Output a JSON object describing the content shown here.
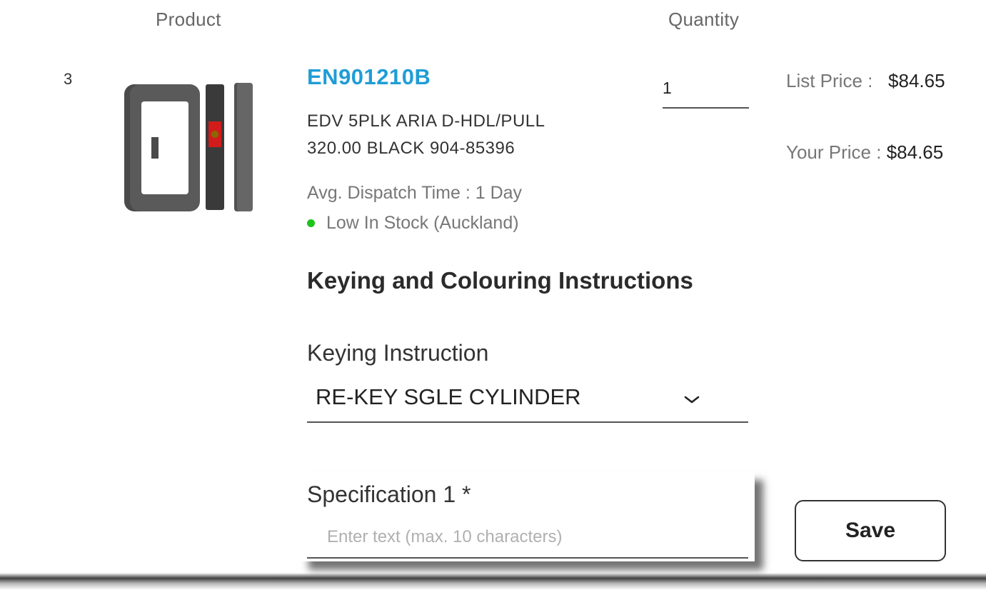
{
  "table_headers": {
    "product": "Product",
    "quantity": "Quantity"
  },
  "line_item": {
    "line_number": "3",
    "sku": "EN901210B",
    "description_line1": "EDV 5PLK ARIA D-HDL/PULL",
    "description_line2": "320.00 BLACK 904-85396",
    "dispatch_time": "Avg. Dispatch Time :  1 Day",
    "stock_status": "Low In Stock (Auckland)",
    "stock_color": "#1bc41b",
    "quantity": "1",
    "list_price_label": "List Price :",
    "list_price_value": "$84.65",
    "your_price_label": "Your Price :",
    "your_price_value": "$84.65"
  },
  "keying": {
    "section_title": "Keying and Colouring Instructions",
    "instruction_label": "Keying Instruction",
    "instruction_value": "RE-KEY SGLE CYLINDER",
    "spec_label": "Specification 1 *",
    "spec_placeholder": "Enter text (max. 10 characters)",
    "save_label": "Save"
  },
  "colors": {
    "sku_link": "#1f9dd6"
  },
  "icons": {
    "dropdown": "chevron-down-icon"
  }
}
